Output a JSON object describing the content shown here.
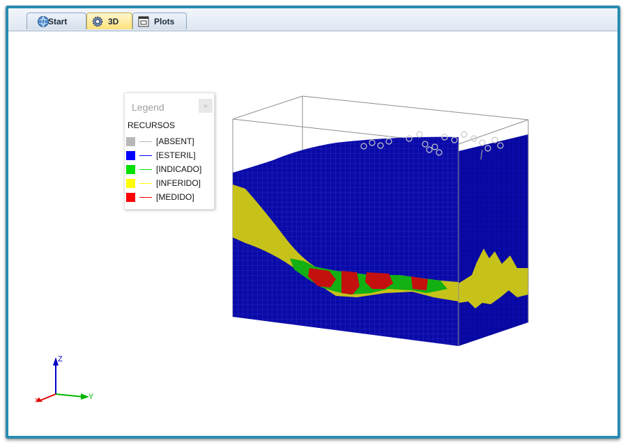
{
  "tabs": [
    {
      "label": "Start",
      "icon": "globe-icon"
    },
    {
      "label": "3D",
      "icon": "gear-globe-icon",
      "active": true
    },
    {
      "label": "Plots",
      "icon": "plot-window-icon"
    }
  ],
  "legend": {
    "title": "Legend",
    "close_label": "»",
    "heading": "RECURSOS",
    "items": [
      {
        "label": "[ABSENT]",
        "color": "#b8b8b8"
      },
      {
        "label": "[ESTERIL]",
        "color": "#0000ff"
      },
      {
        "label": "[INDICADO]",
        "color": "#00e000"
      },
      {
        "label": "[INFERIDO]",
        "color": "#ffff00"
      },
      {
        "label": "[MEDIDO]",
        "color": "#ff0000"
      }
    ]
  },
  "axes": {
    "z_label": "Z",
    "y_label": "Y",
    "x_label": "X",
    "z_color": "#0000c8",
    "y_color": "#00b400",
    "x_color": "#e00000"
  },
  "model_colors": {
    "esteril": "#0a0aa8",
    "inferido": "#c7c21a",
    "indicado": "#12b012",
    "medido": "#c51010",
    "bbox": "#8c8c8c"
  }
}
